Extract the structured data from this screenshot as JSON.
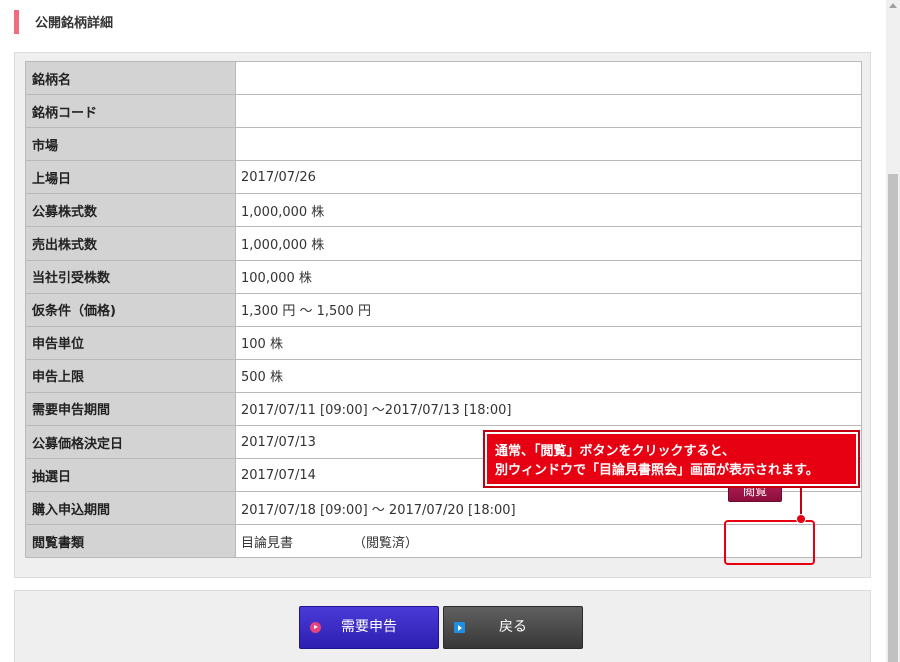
{
  "header": {
    "title": "公開銘柄詳細"
  },
  "details": {
    "rows": [
      {
        "label": "銘柄名",
        "value": ""
      },
      {
        "label": "銘柄コード",
        "value": ""
      },
      {
        "label": "市場",
        "value": ""
      },
      {
        "label": "上場日",
        "value": "2017/07/26"
      },
      {
        "label": "公募株式数",
        "value": "1,000,000 株"
      },
      {
        "label": "売出株式数",
        "value": "1,000,000 株"
      },
      {
        "label": "当社引受株数",
        "value": "100,000 株"
      },
      {
        "label": "仮条件（価格)",
        "value": "1,300 円 ～ 1,500 円"
      },
      {
        "label": "申告単位",
        "value": "100 株"
      },
      {
        "label": "申告上限",
        "value": "500 株"
      },
      {
        "label": "需要申告期間",
        "value": "2017/07/11 [09:00] ～2017/07/13 [18:00]"
      },
      {
        "label": "公募価格決定日",
        "value": "2017/07/13"
      },
      {
        "label": "抽選日",
        "value": "2017/07/14"
      },
      {
        "label": "購入申込期間",
        "value": "2017/07/18 [09:00] ～ 2017/07/20 [18:00]"
      }
    ],
    "documents": {
      "label": "閲覧書類",
      "name": "目論見書",
      "status": "（閲覧済）",
      "browse_button": "閲覧"
    }
  },
  "callout": {
    "line1": "通常、「閲覧」ボタンをクリックすると、",
    "line2": "別ウィンドウで「目論見書照会」画面が表示されます。"
  },
  "footer": {
    "demand_button": "需要申告",
    "back_button": "戻る"
  },
  "colors": {
    "accent": "#f26b7e",
    "browse_button": "#9e1447",
    "callout": "#e60012",
    "demand_button": "#3a2cc8",
    "back_button": "#4a4a4a"
  },
  "icons": {
    "demand_button_icon": "play-circle-icon",
    "back_button_icon": "arrow-right-square-icon"
  }
}
